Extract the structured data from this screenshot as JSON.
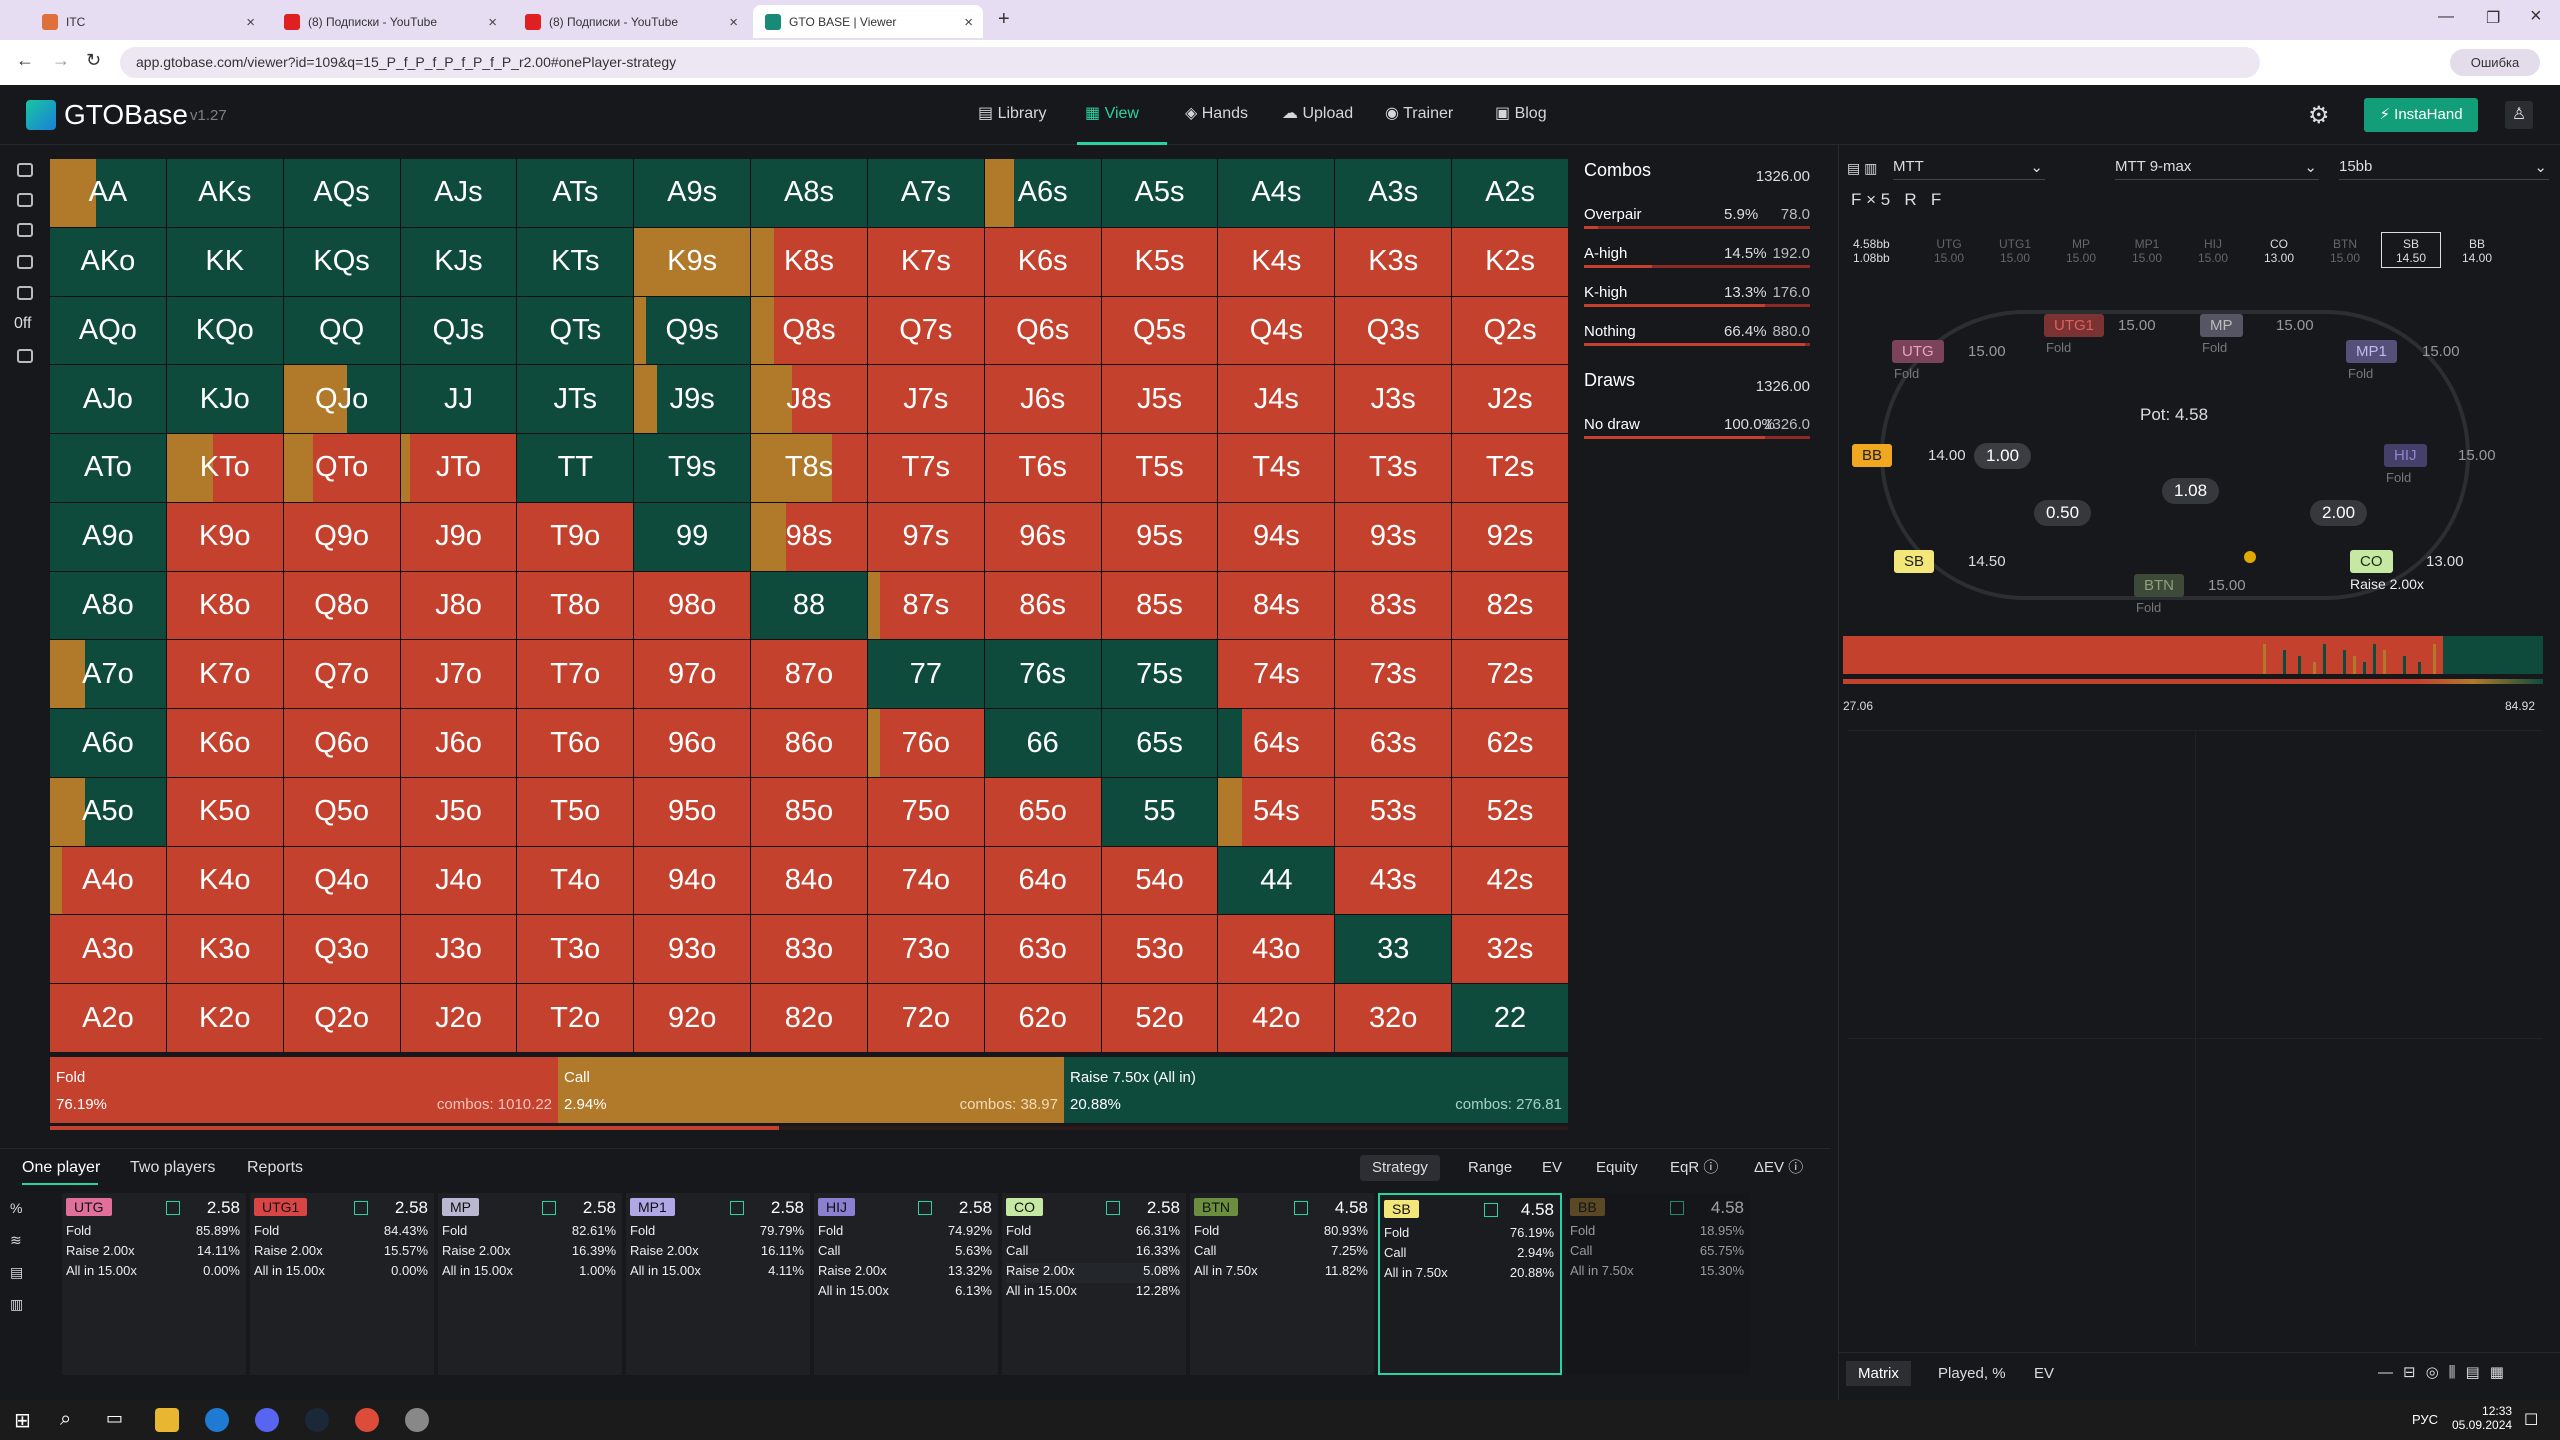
{
  "browser": {
    "tabs": [
      {
        "title": "ITC",
        "color": "#e0703a"
      },
      {
        "title": "(8) Подписки - YouTube",
        "color": "#e02020"
      },
      {
        "title": "(8) Подписки - YouTube",
        "color": "#e02020"
      },
      {
        "title": "GTO BASE | Viewer",
        "color": "#1a8a78"
      }
    ],
    "url": "app.gtobase.com/viewer?id=109&q=15_P_f_P_f_P_f_P_f_P_r2.00#onePlayer-strategy",
    "error": "Ошибка"
  },
  "app": {
    "logo": "GTOBase",
    "version": "v1.27",
    "nav": [
      "Library",
      "View",
      "Hands",
      "Upload",
      "Trainer",
      "Blog"
    ],
    "instahand": "InstaHand"
  },
  "colors": {
    "fold": "#c4412e",
    "call": "#b07a2a",
    "raise": "#0f4b3c"
  },
  "grid": [
    [
      "AA",
      "AKs",
      "AQs",
      "AJs",
      "ATs",
      "A9s",
      "A8s",
      "A7s",
      "A6s",
      "A5s",
      "A4s",
      "A3s",
      "A2s"
    ],
    [
      "AKo",
      "KK",
      "KQs",
      "KJs",
      "KTs",
      "K9s",
      "K8s",
      "K7s",
      "K6s",
      "K5s",
      "K4s",
      "K3s",
      "K2s"
    ],
    [
      "AQo",
      "KQo",
      "QQ",
      "QJs",
      "QTs",
      "Q9s",
      "Q8s",
      "Q7s",
      "Q6s",
      "Q5s",
      "Q4s",
      "Q3s",
      "Q2s"
    ],
    [
      "AJo",
      "KJo",
      "QJo",
      "JJ",
      "JTs",
      "J9s",
      "J8s",
      "J7s",
      "J6s",
      "J5s",
      "J4s",
      "J3s",
      "J2s"
    ],
    [
      "ATo",
      "KTo",
      "QTo",
      "JTo",
      "TT",
      "T9s",
      "T8s",
      "T7s",
      "T6s",
      "T5s",
      "T4s",
      "T3s",
      "T2s"
    ],
    [
      "A9o",
      "K9o",
      "Q9o",
      "J9o",
      "T9o",
      "99",
      "98s",
      "97s",
      "96s",
      "95s",
      "94s",
      "93s",
      "92s"
    ],
    [
      "A8o",
      "K8o",
      "Q8o",
      "J8o",
      "T8o",
      "98o",
      "88",
      "87s",
      "86s",
      "85s",
      "84s",
      "83s",
      "82s"
    ],
    [
      "A7o",
      "K7o",
      "Q7o",
      "J7o",
      "T7o",
      "97o",
      "87o",
      "77",
      "76s",
      "75s",
      "74s",
      "73s",
      "72s"
    ],
    [
      "A6o",
      "K6o",
      "Q6o",
      "J6o",
      "T6o",
      "96o",
      "86o",
      "76o",
      "66",
      "65s",
      "64s",
      "63s",
      "62s"
    ],
    [
      "A5o",
      "K5o",
      "Q5o",
      "J5o",
      "T5o",
      "95o",
      "85o",
      "75o",
      "65o",
      "55",
      "54s",
      "53s",
      "52s"
    ],
    [
      "A4o",
      "K4o",
      "Q4o",
      "J4o",
      "T4o",
      "94o",
      "84o",
      "74o",
      "64o",
      "54o",
      "44",
      "43s",
      "42s"
    ],
    [
      "A3o",
      "K3o",
      "Q3o",
      "J3o",
      "T3o",
      "93o",
      "83o",
      "73o",
      "63o",
      "53o",
      "43o",
      "33",
      "32s"
    ],
    [
      "A2o",
      "K2o",
      "Q2o",
      "J2o",
      "T2o",
      "92o",
      "82o",
      "72o",
      "62o",
      "52o",
      "42o",
      "32o",
      "22"
    ]
  ],
  "mix": {
    "AA": [
      0,
      0.4,
      0.6
    ],
    "AKs": [
      0,
      0,
      1
    ],
    "AQs": [
      0,
      0,
      1
    ],
    "AJs": [
      0,
      0,
      1
    ],
    "ATs": [
      0,
      0,
      1
    ],
    "A9s": [
      0,
      0,
      1
    ],
    "A8s": [
      0,
      0,
      1
    ],
    "A7s": [
      0,
      0,
      1
    ],
    "A6s": [
      0,
      0.25,
      0.75
    ],
    "A5s": [
      0,
      0,
      1
    ],
    "A4s": [
      0,
      0,
      1
    ],
    "A3s": [
      0,
      0,
      1
    ],
    "A2s": [
      0,
      0,
      1
    ],
    "AKo": [
      0,
      0,
      1
    ],
    "KK": [
      0,
      0,
      1
    ],
    "KQs": [
      0,
      0,
      1
    ],
    "KJs": [
      0,
      0,
      1
    ],
    "KTs": [
      0,
      0,
      1
    ],
    "K9s": [
      0,
      1,
      0
    ],
    "K8s": [
      0.8,
      0.2,
      0
    ],
    "AQo": [
      0,
      0,
      1
    ],
    "KQo": [
      0,
      0,
      1
    ],
    "QQ": [
      0,
      0,
      1
    ],
    "QJs": [
      0,
      0,
      1
    ],
    "QTs": [
      0,
      0,
      1
    ],
    "Q9s": [
      0,
      0.1,
      0.9
    ],
    "Q8s": [
      0.8,
      0.2,
      0
    ],
    "AJo": [
      0,
      0,
      1
    ],
    "KJo": [
      0,
      0,
      1
    ],
    "QJo": [
      0,
      0.55,
      0.45
    ],
    "JJ": [
      0,
      0,
      1
    ],
    "JTs": [
      0,
      0,
      1
    ],
    "J9s": [
      0,
      0.2,
      0.8
    ],
    "J8s": [
      0.65,
      0.35,
      0
    ],
    "ATo": [
      0,
      0,
      1
    ],
    "KTo": [
      0.6,
      0.4,
      0
    ],
    "QTo": [
      0.75,
      0.25,
      0
    ],
    "JTo": [
      0.92,
      0.08,
      0
    ],
    "TT": [
      0,
      0,
      1
    ],
    "T9s": [
      0,
      0,
      1
    ],
    "T8s": [
      0.3,
      0.7,
      0
    ],
    "A9o": [
      0,
      0,
      1
    ],
    "99": [
      0,
      0,
      1
    ],
    "98s": [
      0.7,
      0.3,
      0
    ],
    "A8o": [
      0,
      0,
      1
    ],
    "88": [
      0,
      0,
      1
    ],
    "87s": [
      0.9,
      0.1,
      0
    ],
    "A7o": [
      0,
      0.3,
      0.7
    ],
    "77": [
      0,
      0,
      1
    ],
    "76s": [
      0,
      0,
      1
    ],
    "75s": [
      0,
      0,
      1
    ],
    "A6o": [
      0,
      0,
      1
    ],
    "76o": [
      0.9,
      0.1,
      0
    ],
    "66": [
      0,
      0,
      1
    ],
    "65s": [
      0,
      0,
      1
    ],
    "64s": [
      0.8,
      0,
      0.2
    ],
    "A5o": [
      0,
      0.3,
      0.7
    ],
    "55": [
      0,
      0,
      1
    ],
    "54s": [
      0.8,
      0.2,
      0
    ],
    "A4o": [
      0.9,
      0.1,
      0
    ],
    "44": [
      0,
      0,
      1
    ],
    "33": [
      0,
      0,
      1
    ],
    "22": [
      0,
      0,
      1
    ]
  },
  "summary": [
    {
      "action": "Fold",
      "pct": "76.19%",
      "combos": "combos: 1010.22"
    },
    {
      "action": "Call",
      "pct": "2.94%",
      "combos": "combos: 38.97"
    },
    {
      "action": "Raise 7.50x (All in)",
      "pct": "20.88%",
      "combos": "combos: 276.81"
    }
  ],
  "combos": {
    "head": "Combos",
    "total": "1326.00",
    "rows": [
      {
        "name": "Overpair",
        "pct": "5.9%",
        "val": "78.0",
        "f": 0.06
      },
      {
        "name": "A-high",
        "pct": "14.5%",
        "val": "192.0",
        "f": 0.3
      },
      {
        "name": "K-high",
        "pct": "13.3%",
        "val": "176.0",
        "f": 0.8
      },
      {
        "name": "Nothing",
        "pct": "66.4%",
        "val": "880.0",
        "f": 0.98
      }
    ],
    "draws_head": "Draws",
    "draws_total": "1326.00",
    "draws": [
      {
        "name": "No draw",
        "pct": "100.0%",
        "val": "1326.0",
        "f": 0.8
      }
    ]
  },
  "right": {
    "dd": [
      "MTT",
      "MTT 9-max",
      "15bb"
    ],
    "actions": [
      "F × 5",
      "R",
      "F"
    ],
    "effective": "4.58bb",
    "effective2": "1.08bb",
    "positions": [
      {
        "p": "UTG",
        "s": "15.00"
      },
      {
        "p": "UTG1",
        "s": "15.00"
      },
      {
        "p": "MP",
        "s": "15.00"
      },
      {
        "p": "MP1",
        "s": "15.00"
      },
      {
        "p": "HIJ",
        "s": "15.00"
      },
      {
        "p": "CO",
        "s": "13.00"
      },
      {
        "p": "BTN",
        "s": "15.00"
      },
      {
        "p": "SB",
        "s": "14.50"
      },
      {
        "p": "BB",
        "s": "14.00"
      }
    ],
    "pot": "Pot: 4.58",
    "fold": "Fold",
    "raise": "Raise 2.00x",
    "chips": [
      "1.00",
      "1.08",
      "0.50",
      "2.00"
    ],
    "range_min": "27.06",
    "range_max": "84.92"
  },
  "tabs_left": [
    "One player",
    "Two players",
    "Reports"
  ],
  "tabs_right": [
    "Strategy",
    "Range",
    "EV",
    "Equity",
    "EqR",
    "ΔEV"
  ],
  "cards": [
    {
      "pos": "UTG",
      "stack": "2.58",
      "color": "#e0709a",
      "rows": [
        [
          "Fold",
          "85.89%"
        ],
        [
          "Raise 2.00x",
          "14.11%"
        ],
        [
          "All in 15.00x",
          "0.00%"
        ]
      ]
    },
    {
      "pos": "UTG1",
      "stack": "2.58",
      "color": "#d94545",
      "rows": [
        [
          "Fold",
          "84.43%"
        ],
        [
          "Raise 2.00x",
          "15.57%"
        ],
        [
          "All in 15.00x",
          "0.00%"
        ]
      ]
    },
    {
      "pos": "MP",
      "stack": "2.58",
      "color": "#b9b8d3",
      "rows": [
        [
          "Fold",
          "82.61%"
        ],
        [
          "Raise 2.00x",
          "16.39%"
        ],
        [
          "All in 15.00x",
          "1.00%"
        ]
      ]
    },
    {
      "pos": "MP1",
      "stack": "2.58",
      "color": "#b0a8e6",
      "rows": [
        [
          "Fold",
          "79.79%"
        ],
        [
          "Raise 2.00x",
          "16.11%"
        ],
        [
          "All in 15.00x",
          "4.11%"
        ]
      ]
    },
    {
      "pos": "HIJ",
      "stack": "2.58",
      "color": "#8a7fd0",
      "rows": [
        [
          "Fold",
          "74.92%"
        ],
        [
          "Call",
          "5.63%"
        ],
        [
          "Raise 2.00x",
          "13.32%"
        ],
        [
          "All in 15.00x",
          "6.13%"
        ]
      ]
    },
    {
      "pos": "CO",
      "stack": "2.58",
      "color": "#c5e8a3",
      "rows": [
        [
          "Fold",
          "66.31%"
        ],
        [
          "Call",
          "16.33%"
        ],
        [
          "Raise 2.00x",
          "5.08%"
        ],
        [
          "All in 15.00x",
          "12.28%"
        ]
      ]
    },
    {
      "pos": "BTN",
      "stack": "4.58",
      "color": "#6b8f3e",
      "rows": [
        [
          "Fold",
          "80.93%"
        ],
        [
          "Call",
          "7.25%"
        ],
        [
          "All in 7.50x",
          "11.82%"
        ]
      ]
    },
    {
      "pos": "SB",
      "stack": "4.58",
      "color": "#f4e77a",
      "rows": [
        [
          "Fold",
          "76.19%"
        ],
        [
          "Call",
          "2.94%"
        ],
        [
          "All in 7.50x",
          "20.88%"
        ]
      ]
    },
    {
      "pos": "BB",
      "stack": "4.58",
      "color": "#8a6a2e",
      "rows": [
        [
          "Fold",
          "18.95%"
        ],
        [
          "Call",
          "65.75%"
        ],
        [
          "All in 7.50x",
          "15.30%"
        ]
      ]
    }
  ],
  "bottom_right": [
    "Matrix",
    "Played, %",
    "EV"
  ],
  "clock": {
    "time": "12:33",
    "date": "05.09.2024",
    "lang": "РУС"
  }
}
